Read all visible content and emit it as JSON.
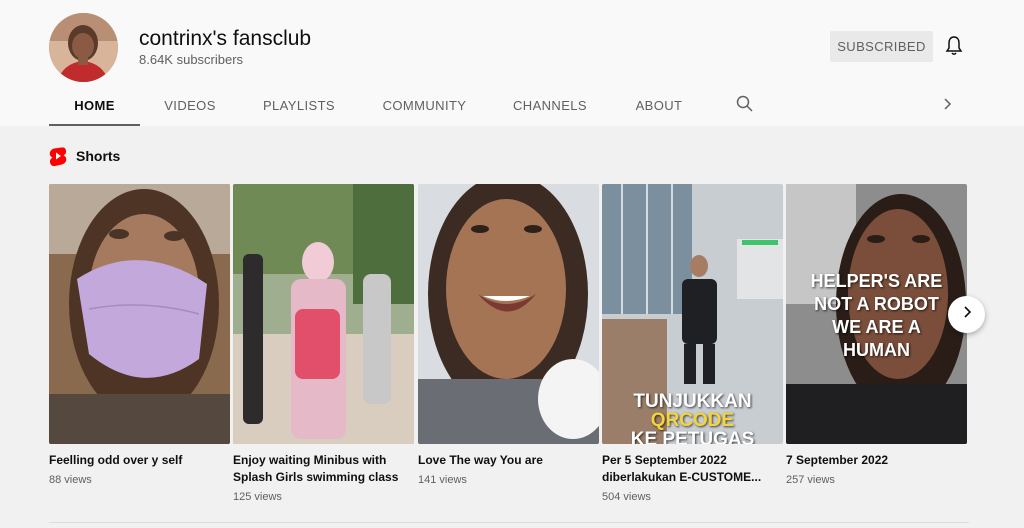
{
  "channel": {
    "name": "contrinx's fansclub",
    "subscribers": "8.64K subscribers",
    "subscribe_label": "SUBSCRIBED"
  },
  "tabs": [
    {
      "label": "HOME",
      "active": true
    },
    {
      "label": "VIDEOS"
    },
    {
      "label": "PLAYLISTS"
    },
    {
      "label": "COMMUNITY"
    },
    {
      "label": "CHANNELS"
    },
    {
      "label": "ABOUT"
    }
  ],
  "icons": {
    "bell": "bell-icon",
    "search": "search-icon",
    "tabs_next": "chevron-right-icon",
    "shorts": "shorts-logo-icon",
    "carousel_next": "chevron-right-icon"
  },
  "colors": {
    "shorts_red": "#ff0000",
    "overlay_yellow": "#f5d33a"
  },
  "shorts": {
    "title": "Shorts",
    "items": [
      {
        "title": "Feelling odd over y self",
        "views": "88 views"
      },
      {
        "title": "Enjoy waiting Minibus with Splash Girls swimming class",
        "views": "125 views"
      },
      {
        "title": "Love The way You are",
        "views": "141 views"
      },
      {
        "title": "Per 5 September 2022 diberlakukan E-CUSTOME...",
        "views": "504 views",
        "overlay_line1": "TUNJUKKAN",
        "overlay_line2": "QRCODE",
        "overlay_line3": "KE PETUGAS"
      },
      {
        "title": "7 September 2022",
        "views": "257 views",
        "overlay_line1": "HELPER'S ARE",
        "overlay_line2": "NOT A ROBOT",
        "overlay_line3": "WE ARE A",
        "overlay_line4": "HUMAN"
      }
    ]
  }
}
